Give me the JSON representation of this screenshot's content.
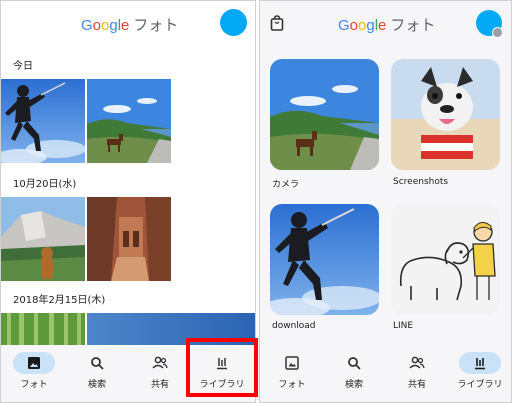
{
  "left": {
    "logo": {
      "letters": [
        "G",
        "o",
        "o",
        "g",
        "l",
        "e"
      ],
      "suffix": "フォト"
    },
    "sections": [
      {
        "date": "今日"
      },
      {
        "date": "10月20日(水)"
      },
      {
        "date": "2018年2月15日(木)"
      }
    ],
    "nav": [
      {
        "label": "フォト",
        "icon": "photo-icon"
      },
      {
        "label": "検索",
        "icon": "search-icon"
      },
      {
        "label": "共有",
        "icon": "people-icon"
      },
      {
        "label": "ライブラリ",
        "icon": "library-icon"
      }
    ],
    "active_nav": "フォト",
    "highlight_color": "#ff0000"
  },
  "right": {
    "logo": {
      "letters": [
        "G",
        "o",
        "o",
        "g",
        "l",
        "e"
      ],
      "suffix": "フォト"
    },
    "albums": [
      {
        "label": "カメラ"
      },
      {
        "label": "Screenshots"
      },
      {
        "label": "download"
      },
      {
        "label": "LINE"
      }
    ],
    "nav": [
      {
        "label": "フォト",
        "icon": "photo-icon"
      },
      {
        "label": "検索",
        "icon": "search-icon"
      },
      {
        "label": "共有",
        "icon": "people-icon"
      },
      {
        "label": "ライブラリ",
        "icon": "library-icon"
      }
    ],
    "active_nav": "ライブラリ"
  },
  "colors": {
    "google_blue": "#4285f4",
    "google_red": "#ea4335",
    "google_yellow": "#fbbc05",
    "google_green": "#34a853",
    "avatar": "#03a9f4",
    "active_pill": "#c9e2f8"
  }
}
